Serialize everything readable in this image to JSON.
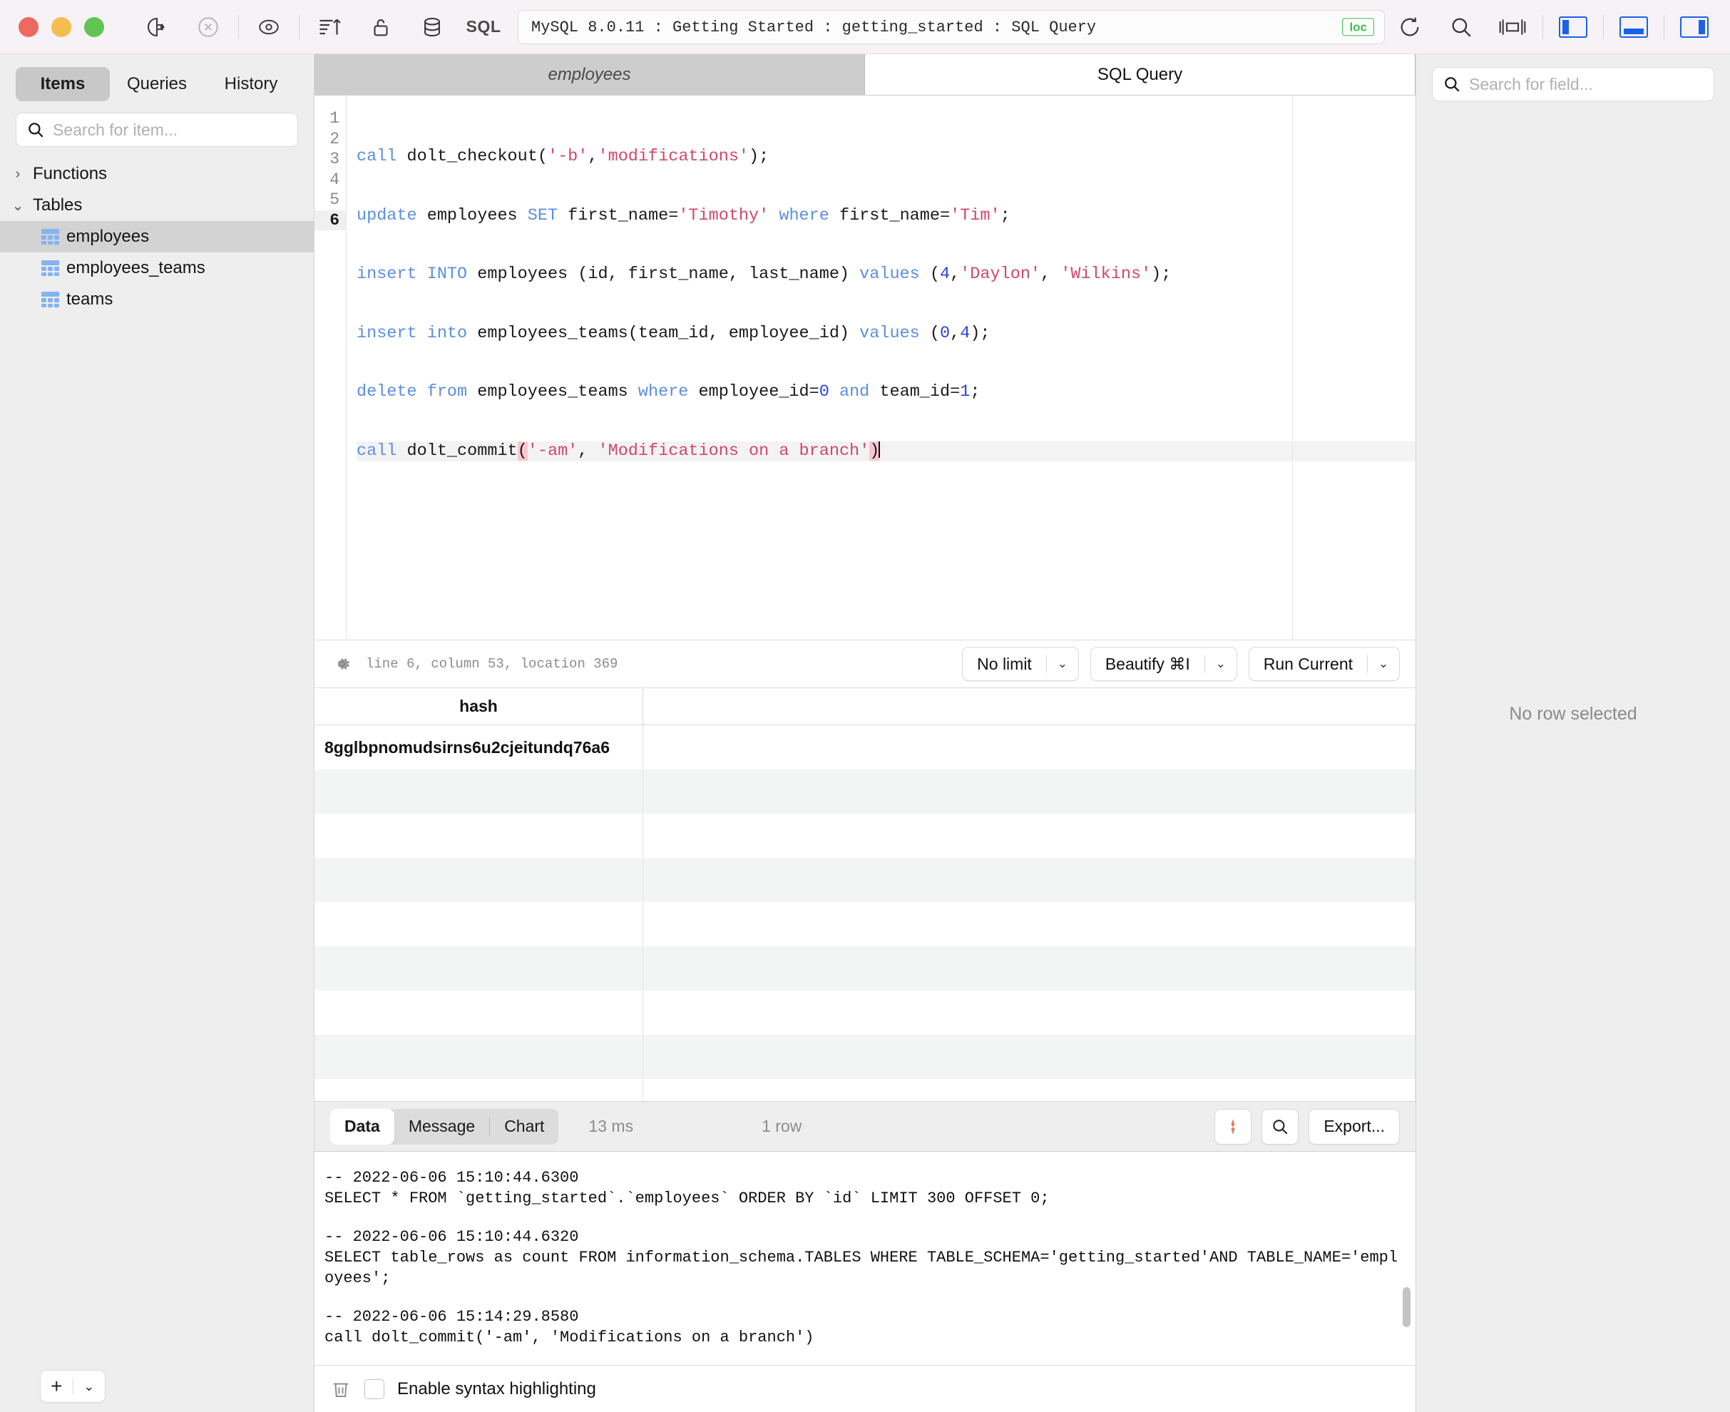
{
  "titlebar": {
    "title": "MySQL 8.0.11 : Getting Started : getting_started : SQL Query",
    "loc_badge": "loc",
    "sql_label": "SQL",
    "icons": [
      "plug-icon",
      "disconnect-icon",
      "eye-icon",
      "sort-ascending-icon",
      "lock-icon",
      "database-icon"
    ],
    "right_icons": [
      "refresh-icon",
      "search-icon",
      "split-view-icon",
      "left-panel-icon",
      "bottom-panel-icon",
      "right-panel-icon"
    ]
  },
  "sidebar": {
    "tabs": [
      {
        "label": "Items",
        "active": true
      },
      {
        "label": "Queries",
        "active": false
      },
      {
        "label": "History",
        "active": false
      }
    ],
    "search_placeholder": "Search for item...",
    "groups": [
      {
        "label": "Functions",
        "expanded": false
      },
      {
        "label": "Tables",
        "expanded": true
      }
    ],
    "tables": [
      {
        "label": "employees",
        "selected": true
      },
      {
        "label": "employees_teams",
        "selected": false
      },
      {
        "label": "teams",
        "selected": false
      }
    ],
    "add_button": "+",
    "add_chevron": "⌄"
  },
  "editor": {
    "tabs": [
      {
        "label": "employees",
        "active": false
      },
      {
        "label": "SQL Query",
        "active": true
      }
    ],
    "lines": [
      {
        "n": "1",
        "text": "call dolt_checkout('-b','modifications');"
      },
      {
        "n": "2",
        "text": "update employees SET first_name='Timothy' where first_name='Tim';"
      },
      {
        "n": "3",
        "text": "insert INTO employees (id, first_name, last_name) values (4,'Daylon', 'Wilkins');"
      },
      {
        "n": "4",
        "text": "insert into employees_teams(team_id, employee_id) values (0,4);"
      },
      {
        "n": "5",
        "text": "delete from employees_teams where employee_id=0 and team_id=1;"
      },
      {
        "n": "6",
        "text": "call dolt_commit('-am', 'Modifications on a branch')"
      }
    ],
    "status": "line 6, column 53, location 369",
    "controls": [
      {
        "label": "No limit",
        "chevron": "⌄"
      },
      {
        "label": "Beautify ⌘I",
        "chevron": "⌄"
      },
      {
        "label": "Run Current",
        "chevron": "⌄"
      }
    ]
  },
  "results": {
    "columns": [
      "hash",
      ""
    ],
    "rows": [
      [
        "8gglbpnomudsirns6u2cjeitundq76a6",
        ""
      ]
    ],
    "tabs": [
      {
        "label": "Data",
        "active": true
      },
      {
        "label": "Message",
        "active": false
      },
      {
        "label": "Chart",
        "active": false
      }
    ],
    "duration": "13 ms",
    "row_count": "1 row",
    "export_label": "Export...",
    "pin_icon": "pin-icon",
    "search_icon": "search-icon"
  },
  "console": {
    "entries": [
      "-- 2022-06-06 15:10:44.6300\nSELECT * FROM `getting_started`.`employees` ORDER BY `id` LIMIT 300 OFFSET 0;",
      "-- 2022-06-06 15:10:44.6320\nSELECT table_rows as count FROM information_schema.TABLES WHERE TABLE_SCHEMA='getting_started'AND TABLE_NAME='employees';",
      "-- 2022-06-06 15:14:29.8580\ncall dolt_commit('-am', 'Modifications on a branch')"
    ],
    "footer_label": "Enable syntax highlighting",
    "trash_icon": "trash-icon",
    "checkbox_checked": false
  },
  "rightpanel": {
    "search_placeholder": "Search for field...",
    "empty_message": "No row selected"
  }
}
